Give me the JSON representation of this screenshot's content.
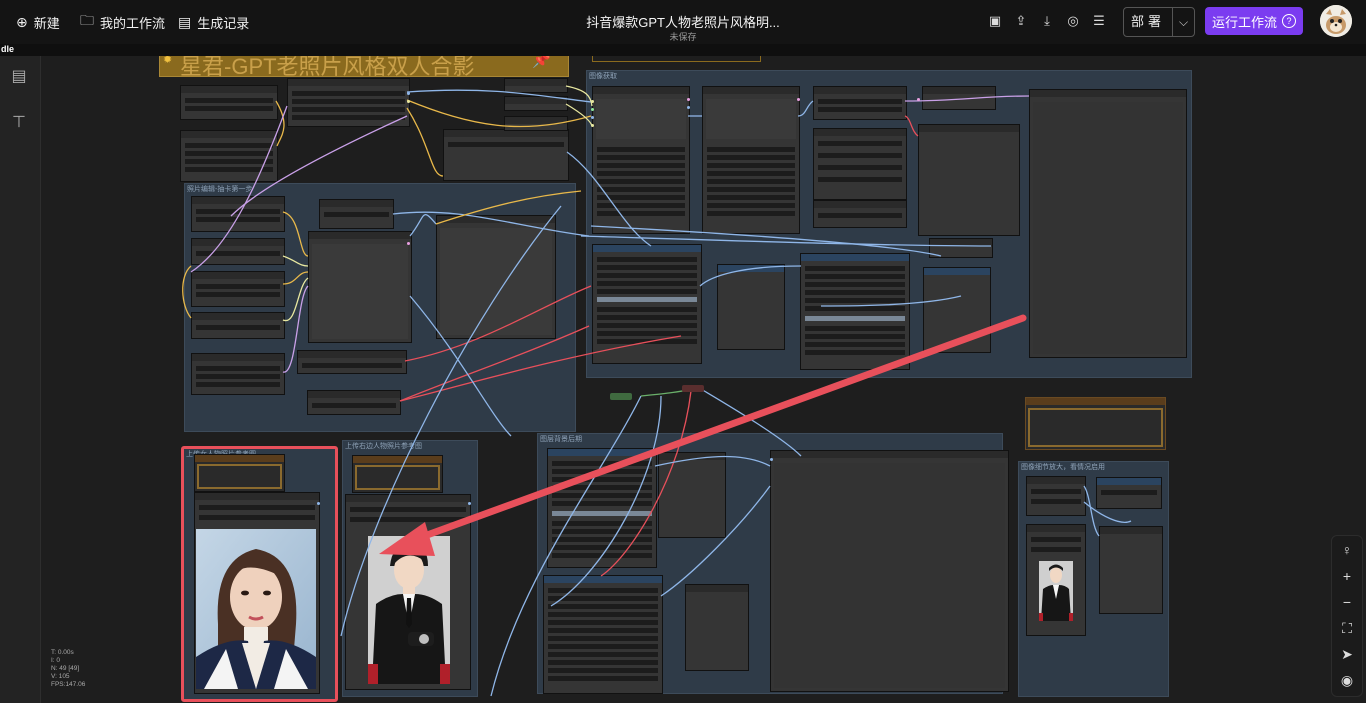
{
  "topbar": {
    "new_label": "新建",
    "workflows_label": "我的工作流",
    "history_label": "生成记录",
    "title": "抖音爆款GPT人物老照片风格明...",
    "subtitle": "未保存",
    "deploy_label": "部署",
    "run_label": "运行工作流"
  },
  "strip_text": "dle",
  "canvas": {
    "banner_text": "星君-GPT老照片风格双人合影",
    "groups": [
      {
        "title": "图像获取"
      },
      {
        "title": "照片编辑-抽卡第一步"
      },
      {
        "title": "上传女人物照片参考图"
      },
      {
        "title": "上传右边人物照片参考图"
      },
      {
        "title": "图层背景后期"
      },
      {
        "title": "图像细节放大，看情况启用"
      }
    ]
  },
  "stats": {
    "t": "T: 0.00s",
    "i": "I: 0",
    "n": "N: 49 [49]",
    "v": "V: 105",
    "fps": "FPS:147.06"
  },
  "colors": {
    "run": "#7b3cf0",
    "highlight": "#e8505b",
    "banner": "#8a6a1e"
  }
}
